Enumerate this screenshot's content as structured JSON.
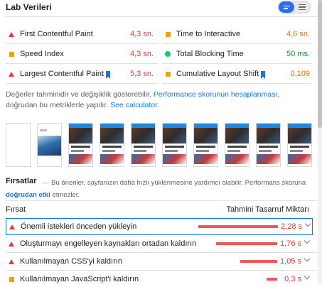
{
  "lab": {
    "title": "Lab Verileri",
    "toggle": {
      "active_icon": "bars-view-icon",
      "inactive_icon": "list-view-icon"
    }
  },
  "metrics": [
    {
      "label": "First Contentful Paint",
      "value": "4,3 sn.",
      "status": "fail",
      "icon": "red-triangle-icon",
      "color": "#e53935"
    },
    {
      "label": "Time to Interactive",
      "value": "4,6 sn.",
      "status": "average",
      "icon": "orange-square-icon",
      "color": "#e8710a"
    },
    {
      "label": "Speed Index",
      "value": "4,3 sn.",
      "status": "average",
      "icon": "orange-square-icon",
      "color": "#e53935"
    },
    {
      "label": "Total Blocking Time",
      "value": "50 ms.",
      "status": "pass",
      "icon": "green-circle-icon",
      "color": "#0a8a3a"
    },
    {
      "label": "Largest Contentful Paint",
      "value": "5,3 sn.",
      "status": "fail",
      "icon": "red-triangle-icon",
      "color": "#e53935"
    },
    {
      "label": "Cumulative Layout Shift",
      "value": "0,109",
      "status": "average",
      "icon": "orange-square-icon",
      "color": "#e8710a"
    }
  ],
  "note": {
    "text1": "Değerler tahminidir ve değişiklik gösterebilir.",
    "link1": "Performance skorunun hesaplanması",
    "text2": ", doğrudan bu metriklerle yapılır.",
    "link2": "See calculator."
  },
  "filmstrip": {
    "frame_count": 10
  },
  "opportunities": {
    "title": "Fırsatlar",
    "dash": "—",
    "desc_text": "Bu öneriler, sayfanızın daha hızlı yüklenmesine yardımcı olabilir. Performans skoruna",
    "desc_link": "doğrudan etki",
    "desc_end": "etmezler.",
    "col_opportunity": "Fırsat",
    "col_savings": "Tahmini Tasarruf Miktarı",
    "items": [
      {
        "label": "Önemli istekleri önceden yükleyin",
        "savings": "2,28 s",
        "fraction": 1.0
      },
      {
        "label": "Oluşturmayı engelleyen kaynakları ortadan kaldırın",
        "savings": "1,76 s",
        "fraction": 0.77
      },
      {
        "label": "Kullanılmayan CSS'yi kaldırın",
        "savings": "1,05 s",
        "fraction": 0.46
      },
      {
        "label": "Kullanılmayan JavaScript'i kaldırın",
        "savings": "0,3 s",
        "fraction": 0.13
      }
    ]
  },
  "colors": {
    "accent": "#1a73e8",
    "fail": "#e53935",
    "average": "#f4a000",
    "pass": "#0cce6b",
    "bar": "#eb5757"
  }
}
